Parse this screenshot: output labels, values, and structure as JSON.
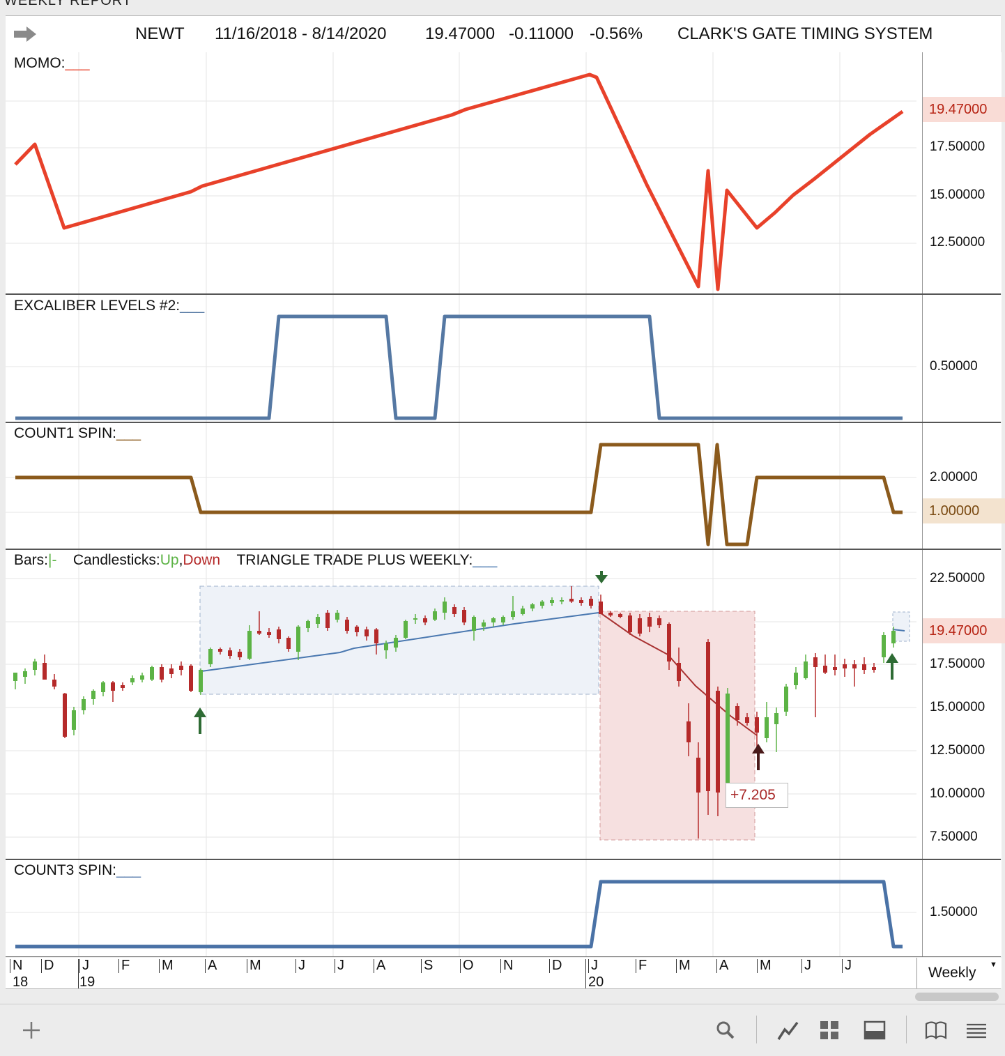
{
  "window": {
    "title": "WEEKLY REPORT"
  },
  "header": {
    "symbol": "NEWT",
    "date_range": "11/16/2018 - 8/14/2020",
    "last": "19.47000",
    "change": "-0.11000",
    "change_pct": "-0.56%",
    "system": "CLARK'S GATE TIMING SYSTEM"
  },
  "panes": {
    "momo": {
      "label": "MOMO:",
      "legend_line": "___",
      "color": "#e8412a",
      "ticks": [
        "17.50000",
        "15.00000",
        "12.50000"
      ],
      "highlight": "19.47000"
    },
    "excal": {
      "label": "EXCALIBER LEVELS #2:",
      "legend_line": "___",
      "color": "#5578a3",
      "ticks": [
        "0.50000"
      ]
    },
    "count1": {
      "label": "COUNT1 SPIN:",
      "legend_line": "___",
      "color": "#8b5a1c",
      "ticks": [
        "2.00000"
      ],
      "highlight": "1.00000"
    },
    "price": {
      "bars_label": "Bars:",
      "bars_symbol": "|-",
      "candles_label": "Candlesticks:",
      "up_label": "Up",
      "comma": ",",
      "down_label": "Down",
      "triangle_label": "TRIANGLE TRADE PLUS WEEKLY:",
      "legend_line": "___",
      "ticks": [
        "22.50000",
        "17.50000",
        "15.00000",
        "12.50000",
        "10.00000",
        "7.50000"
      ],
      "highlight": "19.47000",
      "trade_gain": "+7.205",
      "up_color": "#5cb345",
      "down_color": "#b52a2a"
    },
    "count3": {
      "label": "COUNT3 SPIN:",
      "legend_line": "___",
      "color": "#4a72a6",
      "ticks": [
        "1.50000"
      ]
    }
  },
  "xaxis": {
    "months": [
      "N",
      "D",
      "J",
      "F",
      "M",
      "A",
      "M",
      "J",
      "J",
      "A",
      "S",
      "O",
      "N",
      "D",
      "J",
      "F",
      "M",
      "A",
      "M",
      "J",
      "J"
    ],
    "years": [
      "18",
      "19",
      "20"
    ],
    "interval": "Weekly"
  },
  "toolbar": {
    "icons": [
      "add-icon",
      "search-icon",
      "line-chart-icon",
      "grid-icon",
      "panel-icon",
      "book-icon",
      "menu-icon"
    ]
  }
}
